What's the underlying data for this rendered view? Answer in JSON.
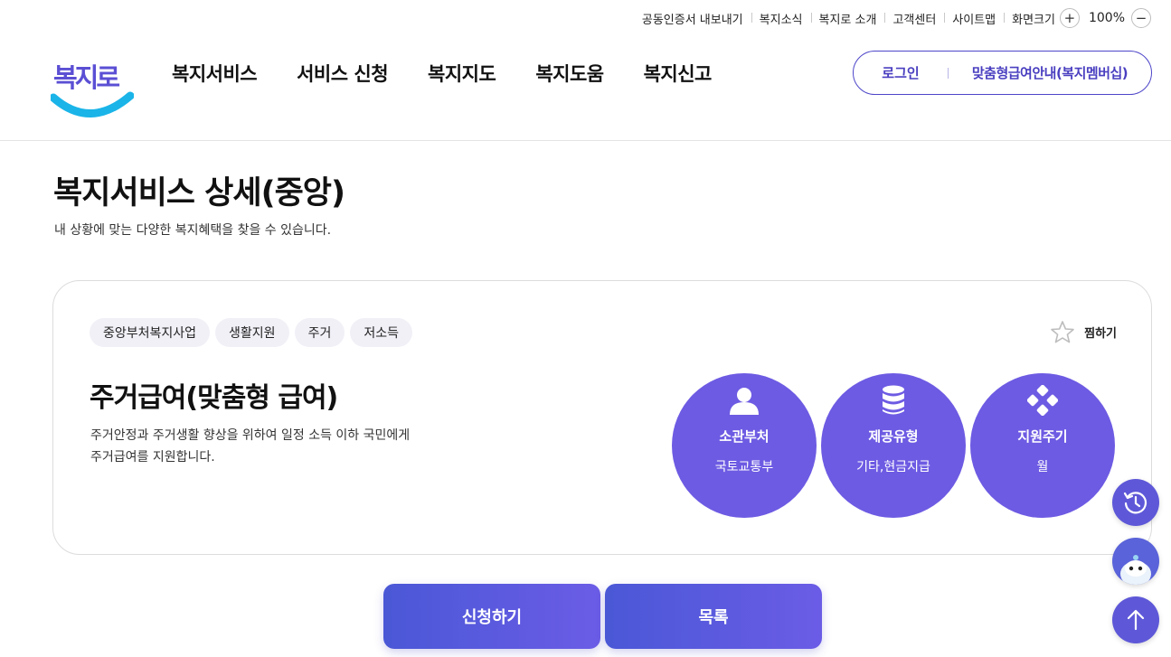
{
  "utility": {
    "links": [
      "공동인증서 내보내기",
      "복지소식",
      "복지로 소개",
      "고객센터",
      "사이트맵"
    ],
    "zoom_label": "화면크기",
    "zoom_in": "+",
    "zoom_value": "100%",
    "zoom_out": "−"
  },
  "logo_text": "복지로",
  "gnb": [
    "복지서비스",
    "서비스 신청",
    "복지지도",
    "복지도움",
    "복지신고"
  ],
  "auth": {
    "login": "로그인",
    "member": "맞춤형급여안내(복지멤버십)"
  },
  "page": {
    "title": "복지서비스 상세(중앙)",
    "subtitle": "내 상황에 맞는 다양한 복지혜택을 찾을 수 있습니다."
  },
  "service": {
    "tags": [
      "중앙부처복지사업",
      "생활지원",
      "주거",
      "저소득"
    ],
    "favorite_label": "찜하기",
    "title": "주거급여(맞춤형 급여)",
    "description": "주거안정과 주거생활 향상을 위하여 일정 소득 이하 국민에게 주거급여를 지원합니다.",
    "info": [
      {
        "icon": "person-icon",
        "label": "소관부처",
        "value": "국토교통부"
      },
      {
        "icon": "database-icon",
        "label": "제공유형",
        "value": "기타,현금지급"
      },
      {
        "icon": "cycle-icon",
        "label": "지원주기",
        "value": "월"
      }
    ]
  },
  "buttons": {
    "apply": "신청하기",
    "list": "목록"
  },
  "colors": {
    "accent": "#6d5be3",
    "border": "#4e46c9",
    "logo_blue": "#1ab4e8"
  }
}
